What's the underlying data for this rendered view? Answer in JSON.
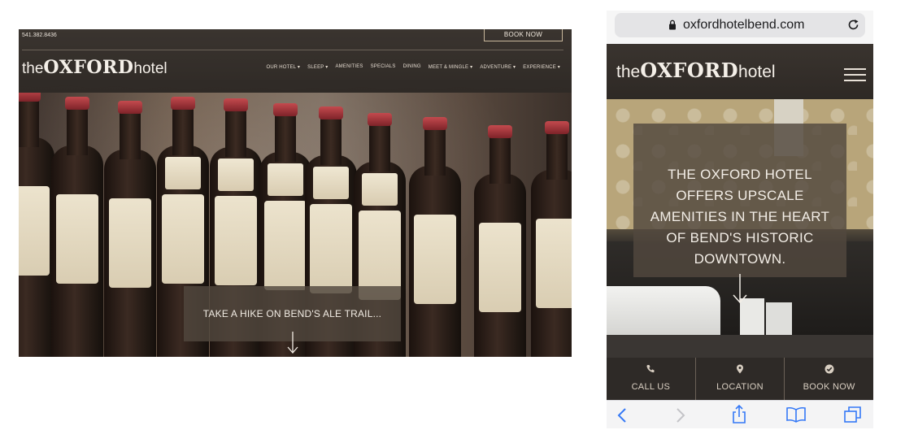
{
  "desktop": {
    "phone": "541.382.8436",
    "book_now": "BOOK NOW",
    "logo": {
      "the": "the",
      "oxford": "OXFORD",
      "hotel": "hotel"
    },
    "nav": [
      "OUR HOTEL ▾",
      "SLEEP ▾",
      "AMENITIES",
      "SPECIALS",
      "DINING",
      "MEET & MINGLE ▾",
      "ADVENTURE ▾",
      "EXPERIENCE ▾"
    ],
    "hero_caption": "TAKE A HIKE ON BEND'S ALE TRAIL..."
  },
  "mobile": {
    "url": "oxfordhotelbend.com",
    "logo": {
      "the": "the",
      "oxford": "OXFORD",
      "hotel": "hotel"
    },
    "hero_caption": "THE OXFORD HOTEL OFFERS UPSCALE AMENITIES IN THE HEART OF BEND'S HISTORIC DOWNTOWN.",
    "actions": [
      {
        "label": "CALL US",
        "icon": "phone-icon"
      },
      {
        "label": "LOCATION",
        "icon": "map-pin-icon"
      },
      {
        "label": "BOOK NOW",
        "icon": "check-circle-icon"
      }
    ],
    "toolbar_icons": [
      "back-icon",
      "forward-icon",
      "share-icon",
      "bookmarks-icon",
      "tabs-icon"
    ]
  },
  "colors": {
    "header_bg": "#332e2a",
    "caption_overlay": "#52483e",
    "accent_border": "#c9b89c",
    "safari_blue": "#3478f6"
  }
}
